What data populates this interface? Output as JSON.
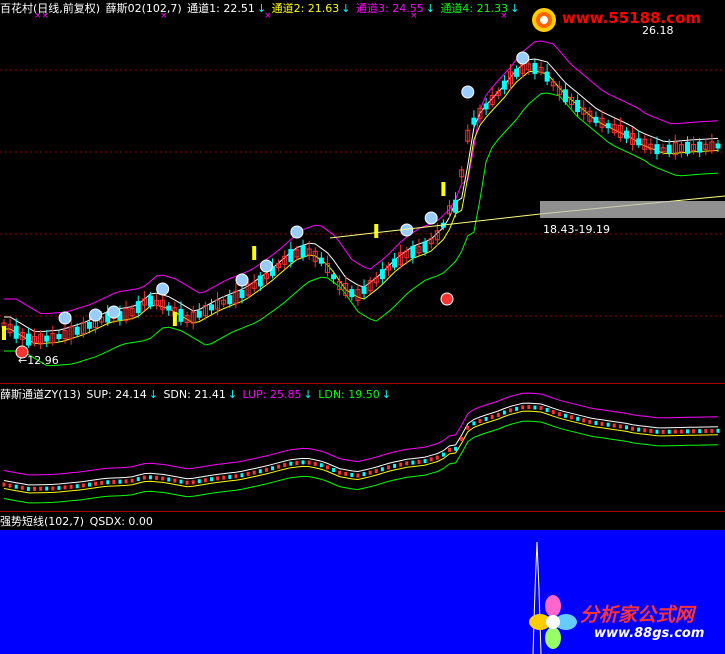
{
  "panel1": {
    "stock": "百花村(日线,前复权)",
    "indicator": "薛斯02(102,7)",
    "items": [
      {
        "label": "通道1: 22.51",
        "color": "#ffffff",
        "arrow": "↓"
      },
      {
        "label": "通道2: 21.63",
        "color": "#ffff00",
        "arrow": "↓"
      },
      {
        "label": "通道3: 24.55",
        "color": "#ff00ff",
        "arrow": "↓"
      },
      {
        "label": "通道4: 21.33",
        "color": "#00ff00",
        "arrow": "↓"
      }
    ],
    "marks": [
      "××",
      "×",
      "×",
      "×",
      "×"
    ],
    "price_high_label": "26.18",
    "price_low_label": "←12.96",
    "trend_label": "18.43-19.19"
  },
  "panel2": {
    "title": "薛斯通道ZY(13)",
    "items": [
      {
        "label": "SUP: 24.14",
        "color": "#ffffff",
        "arrow": "↓"
      },
      {
        "label": "SDN: 21.41",
        "color": "#ffffff",
        "arrow": "↓"
      },
      {
        "label": "LUP: 25.85",
        "color": "#ff00ff",
        "arrow": "↓"
      },
      {
        "label": "LDN: 19.50",
        "color": "#00ff00",
        "arrow": "↓"
      }
    ]
  },
  "panel3": {
    "title": "强势短线(102,7)",
    "value_label": "QSDX: 0.00"
  },
  "logos": {
    "top": "www.55188.com",
    "bottom_cn": "分析家公式网",
    "bottom_url": "www.88gs.com"
  },
  "colors": {
    "background": "#000000",
    "up": "#ff3232",
    "down": "#00ffff",
    "ch1": "#ffffff",
    "ch2": "#ffff00",
    "ch3": "#ff00ff",
    "ch4": "#00ff00",
    "trend": "#ffff80",
    "panel3_bg": "#0000ff"
  },
  "chart_data": {
    "type": "candlestick",
    "high": 26.18,
    "low": 12.96,
    "trendline_range": [
      18.43,
      19.19
    ]
  }
}
